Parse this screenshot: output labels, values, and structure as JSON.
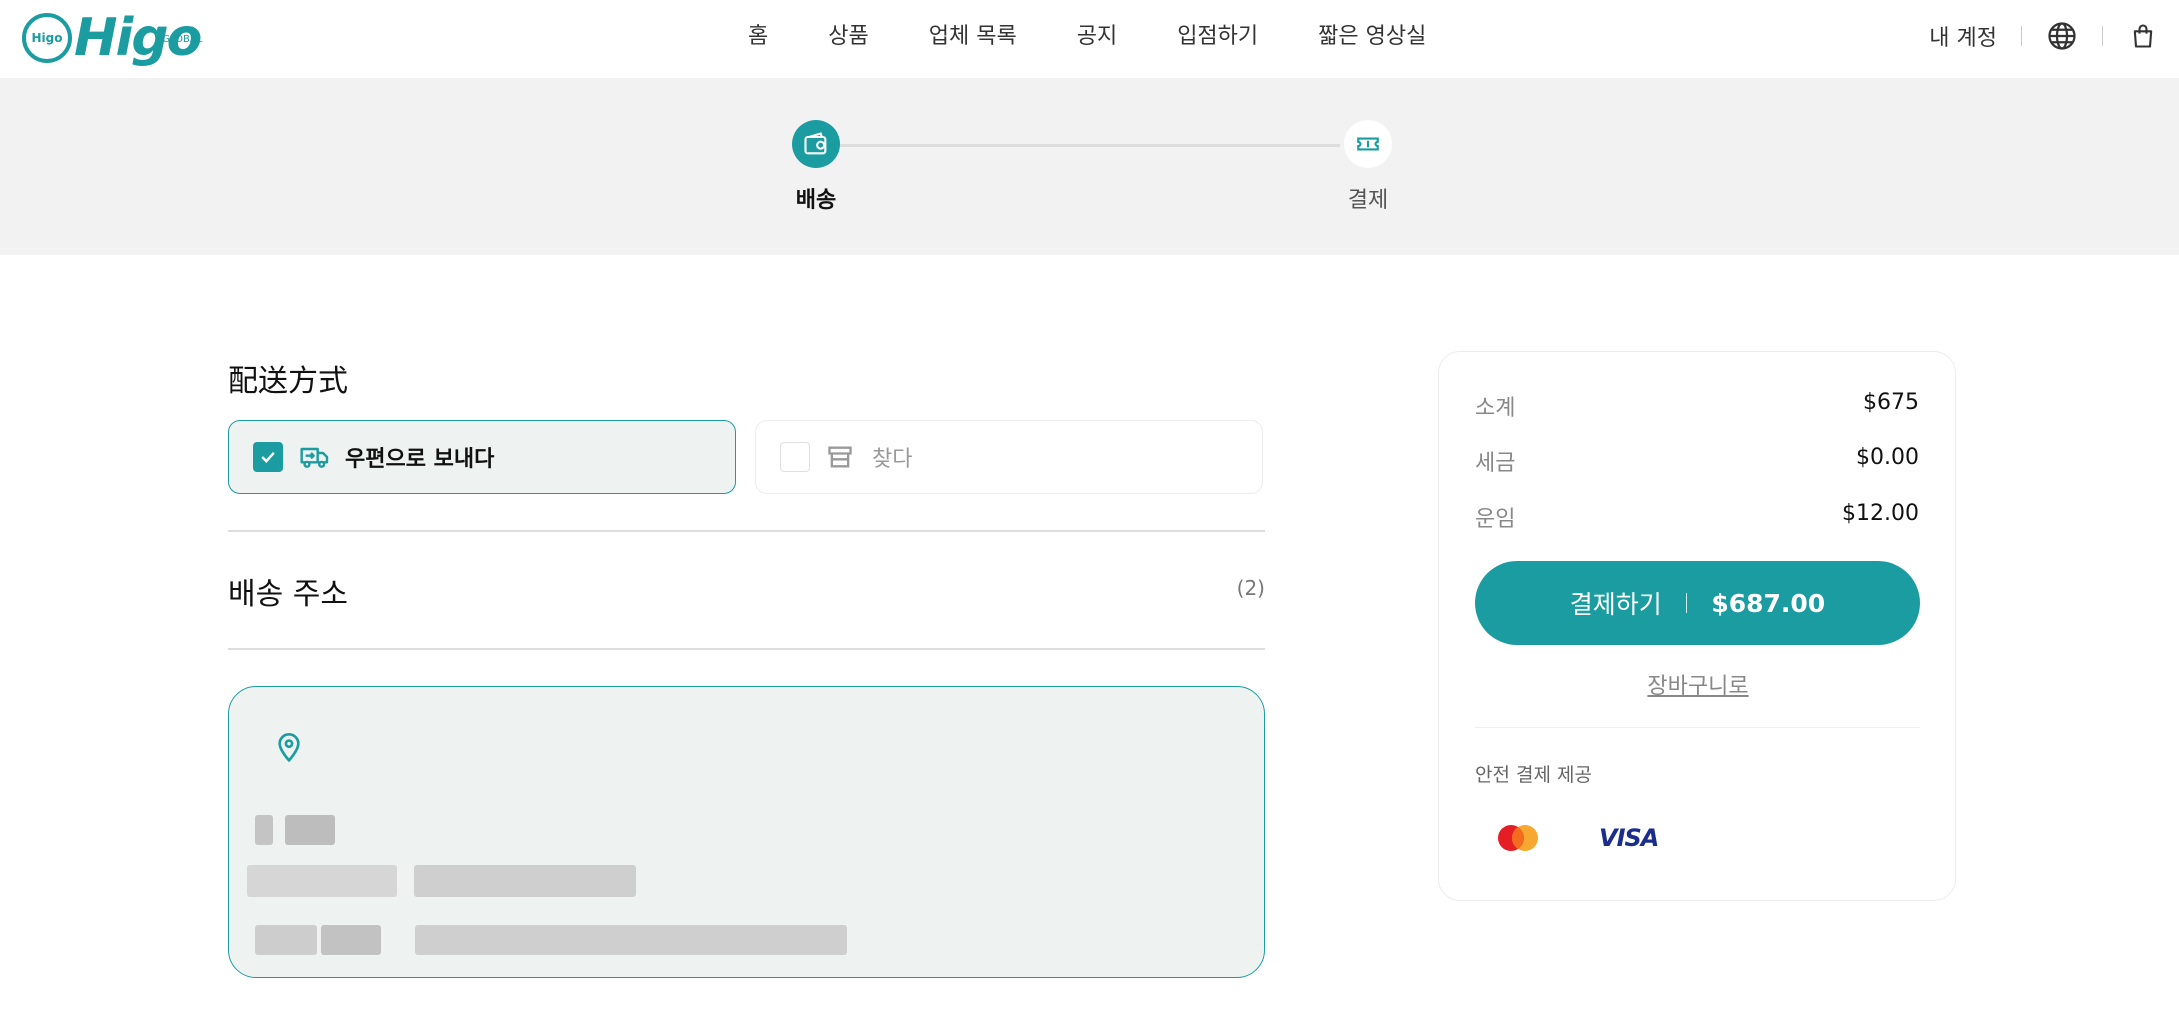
{
  "header": {
    "logo_text": "Higo",
    "logo_sub": "GLOBAL",
    "logo_mark": "Higo",
    "nav": [
      "홈",
      "상품",
      "업체 목록",
      "공지",
      "입점하기",
      "짧은 영상실"
    ],
    "account_label": "내 계정",
    "icons": [
      "globe-icon",
      "shopping-bag-icon"
    ]
  },
  "steps": [
    {
      "label": "배송",
      "icon": "wallet-icon",
      "state": "active"
    },
    {
      "label": "결제",
      "icon": "ticket-icon",
      "state": "inactive"
    }
  ],
  "shipping": {
    "method_title": "配送方式",
    "methods": [
      {
        "label": "우편으로 보내다",
        "icon": "truck-icon",
        "selected": true
      },
      {
        "label": "찾다",
        "icon": "store-icon",
        "selected": false
      }
    ],
    "address_title": "배송 주소",
    "address_count": "(2)",
    "address_card_icon": "map-pin-icon"
  },
  "summary": {
    "rows": [
      {
        "label": "소계",
        "value": "$675"
      },
      {
        "label": "세금",
        "value": "$0.00"
      },
      {
        "label": "운임",
        "value": "$12.00"
      }
    ],
    "pay_button_label": "결제하기",
    "pay_button_amount": "$687.00",
    "cart_link": "장바구니로",
    "secure_label": "안전 결제 제공",
    "card_brands": [
      "mastercard-icon",
      "visa-icon"
    ],
    "visa_text": "VISA"
  },
  "colors": {
    "accent": "#1a9ca0",
    "panel_bg": "#eef3f2",
    "band_bg": "#f2f2f2"
  }
}
